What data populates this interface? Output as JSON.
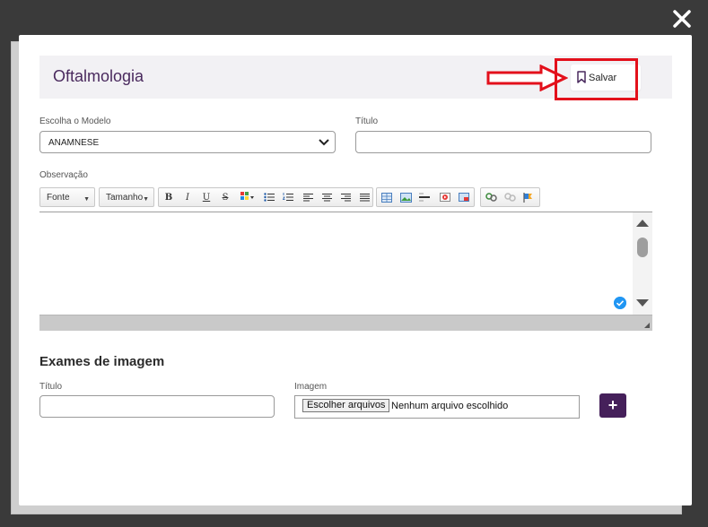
{
  "modal": {
    "title": "Oftalmologia",
    "save_label": "Salvar",
    "accent_color": "#45205a",
    "highlight_color": "#e3101b"
  },
  "form": {
    "model_label": "Escolha o Modelo",
    "model_value": "ANAMNESE",
    "title_label": "Título",
    "title_value": "",
    "observation_label": "Observação"
  },
  "toolbar": {
    "font_label": "Fonte",
    "size_label": "Tamanho",
    "buttons": [
      "bold",
      "italic",
      "underline",
      "strikethrough",
      "text-color",
      "bulleted-list",
      "numbered-list",
      "align-left",
      "align-center",
      "align-right",
      "justify",
      "table",
      "image",
      "horizontal-rule",
      "video",
      "iframe",
      "link",
      "unlink",
      "anchor"
    ]
  },
  "images_section": {
    "heading": "Exames de imagem",
    "title_label": "Título",
    "title_value": "",
    "image_label": "Imagem",
    "file_button": "Escolher arquivos",
    "file_status": "Nenhum arquivo escolhido",
    "add_label": "+"
  }
}
